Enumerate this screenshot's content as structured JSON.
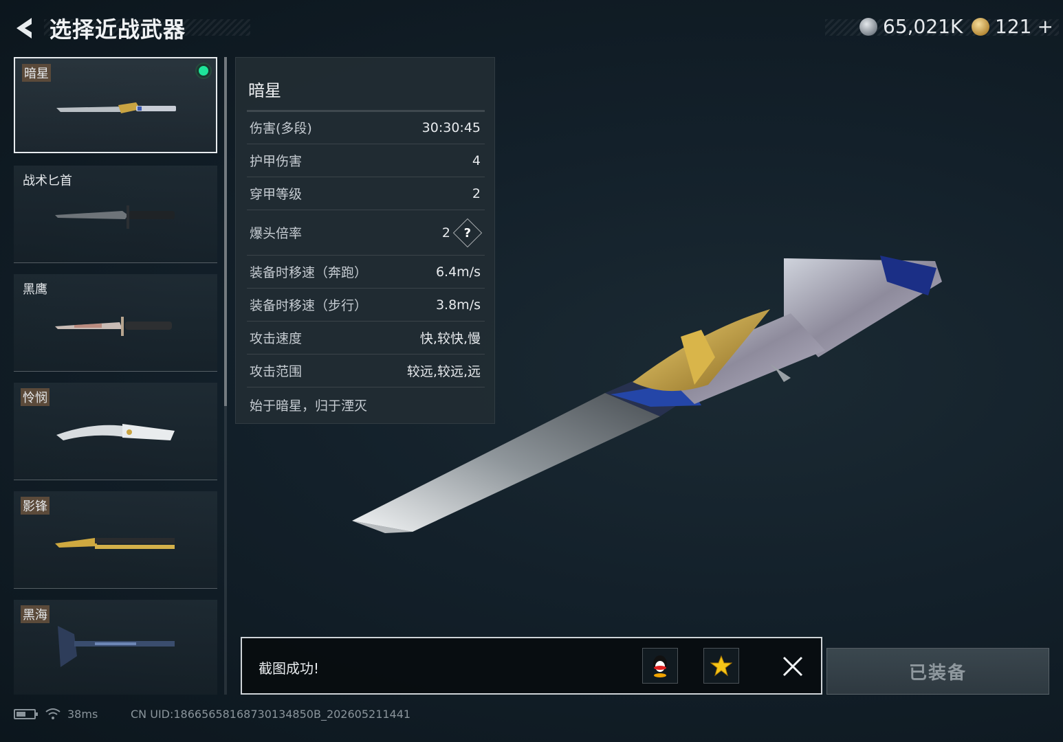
{
  "header": {
    "title": "选择近战武器",
    "silver_amount": "65,021K",
    "gold_amount": "121",
    "plus": "+"
  },
  "weapons": [
    {
      "name": "暗星",
      "tagged": true,
      "selected": true,
      "equipped": true
    },
    {
      "name": "战术匕首",
      "tagged": false
    },
    {
      "name": "黑鹰",
      "tagged": false
    },
    {
      "name": "怜悯",
      "tagged": true
    },
    {
      "name": "影锋",
      "tagged": true
    },
    {
      "name": "黑海",
      "tagged": true
    }
  ],
  "stats": {
    "title": "暗星",
    "rows": [
      {
        "label": "伤害(多段)",
        "value": "30:30:45"
      },
      {
        "label": "护甲伤害",
        "value": "4"
      },
      {
        "label": "穿甲等级",
        "value": "2"
      },
      {
        "label": "爆头倍率",
        "value": "2"
      },
      {
        "label": "装备时移速（奔跑）",
        "value": "6.4m/s"
      },
      {
        "label": "装备时移速（步行）",
        "value": "3.8m/s"
      },
      {
        "label": "攻击速度",
        "value": "快,较快,慢"
      },
      {
        "label": "攻击范围",
        "value": "较远,较远,远"
      }
    ],
    "help_glyph": "?",
    "motto": "始于暗星，归于湮灭"
  },
  "toast": {
    "message": "截图成功!"
  },
  "equip_button": "已装备",
  "status": {
    "ping": "38ms",
    "uid": "CN UID:18665658168730134850B_202605211441"
  },
  "colors": {
    "equipped_dot": "#1ee59a",
    "tag_bg": "#5b4a3a",
    "panel_bg": "#222c33"
  }
}
